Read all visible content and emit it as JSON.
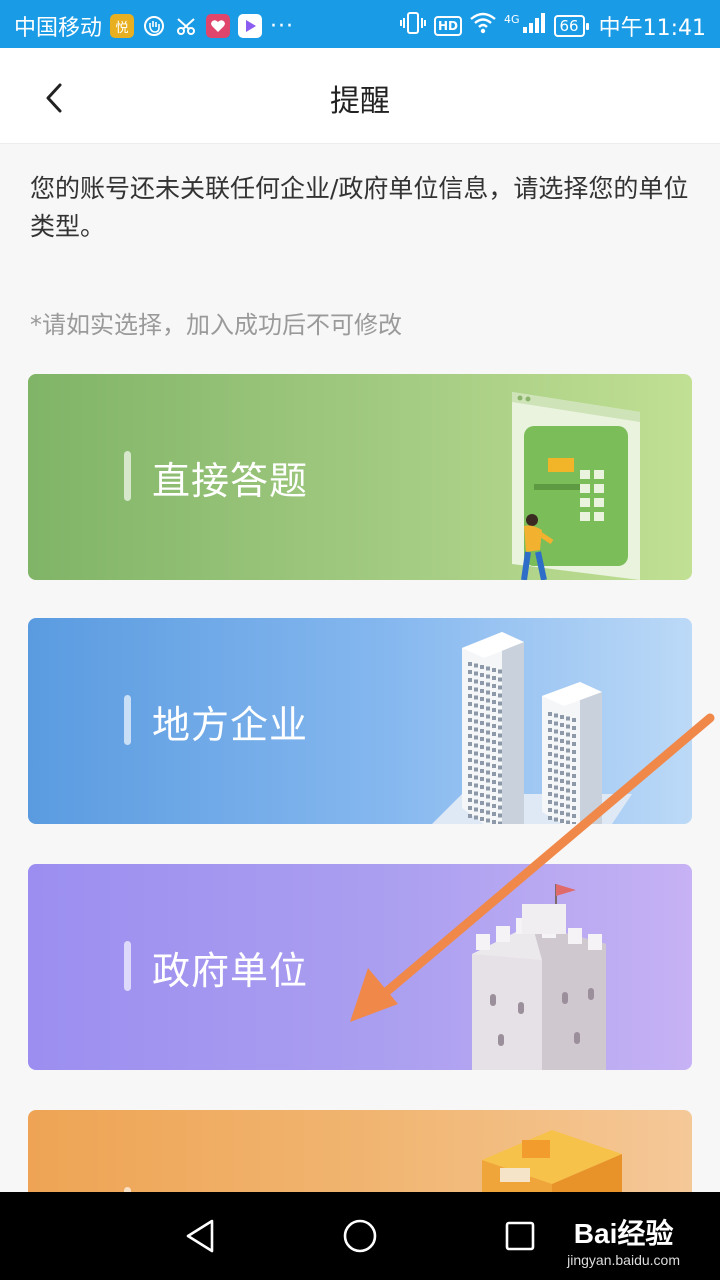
{
  "status_bar": {
    "carrier": "中国移动",
    "app_icon_1": "悦",
    "ellipsis": "···",
    "hd": "HD",
    "network": "4G",
    "battery": "66",
    "time": "中午11:41",
    "icons": [
      "app-badge-icon",
      "hand-icon",
      "scissors-icon",
      "heart-app-icon",
      "video-app-icon",
      "vibrate-icon",
      "wifi-icon",
      "signal-icon"
    ]
  },
  "header": {
    "title": "提醒"
  },
  "notice": "您的账号还未关联任何企业/政府单位信息，请选择您的单位类型。",
  "hint": "*请如实选择，加入成功后不可修改",
  "cards": [
    {
      "label": "直接答题",
      "color": "#8fc173"
    },
    {
      "label": "地方企业",
      "color": "#6aa7e6"
    },
    {
      "label": "政府单位",
      "color": "#a496f0"
    },
    {
      "label": "",
      "color": "#f0ad61"
    }
  ],
  "annotation": {
    "arrow_color": "#f0884a"
  },
  "navbar": {
    "buttons": [
      "back-triangle-icon",
      "home-circle-icon",
      "recents-square-icon"
    ]
  },
  "watermark": {
    "logo": "Bai经验",
    "url": "jingyan.baidu.com"
  }
}
